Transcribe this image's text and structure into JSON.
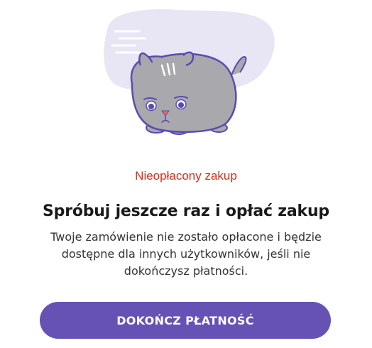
{
  "status": {
    "label": "Nieopłacony zakup",
    "color": "#d32f1e"
  },
  "headline": "Spróbuj jeszcze raz i opłać zakup",
  "description": "Twoje zamówienie nie zostało opłacone i będzie dostępne dla innych użytkowników, jeśli nie dokończysz płatności.",
  "actions": {
    "primary_label": "DOKOŃCZ PŁATNOŚĆ",
    "primary_color": "#6652b4"
  },
  "illustration": {
    "icon": "sad-cat-icon",
    "blob_color": "#e8e6f5",
    "cat_color": "#a9a9ad",
    "outline_color": "#5a4bb0"
  }
}
